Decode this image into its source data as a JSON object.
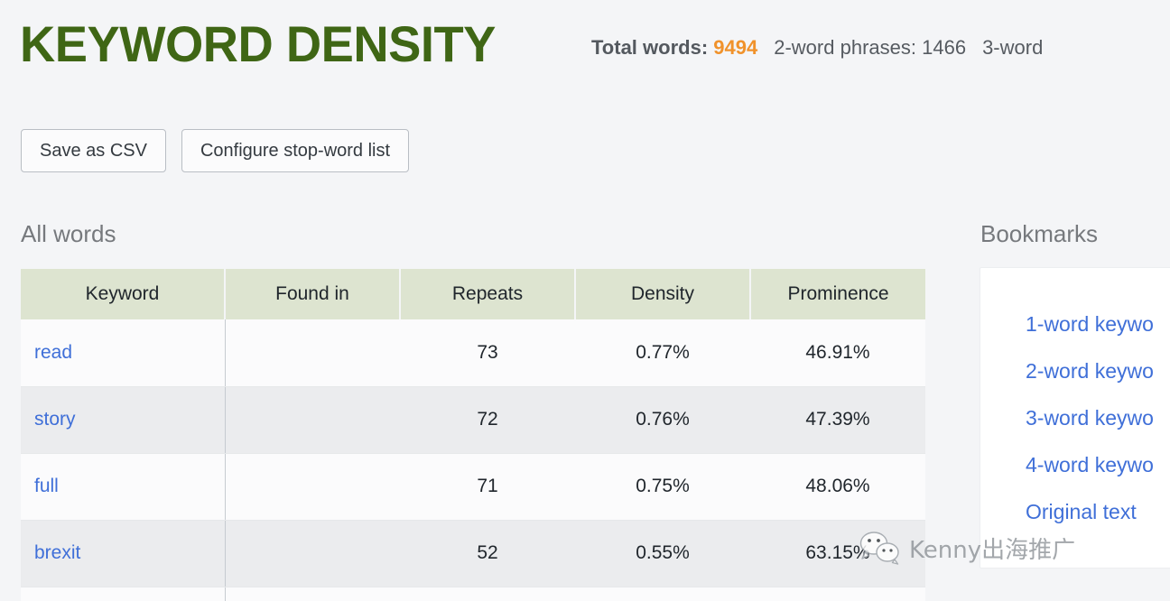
{
  "header": {
    "title": "KEYWORD DENSITY",
    "stats": {
      "total_words_label": "Total words:",
      "total_words_value": "9494",
      "two_word_label": "2-word phrases:",
      "two_word_value": "1466",
      "three_word_label": "3-word"
    }
  },
  "toolbar": {
    "save_csv_label": "Save as CSV",
    "configure_stopwords_label": "Configure stop-word list"
  },
  "sections": {
    "all_words_label": "All words",
    "bookmarks_label": "Bookmarks"
  },
  "table": {
    "columns": [
      "Keyword",
      "Found in",
      "Repeats",
      "Density",
      "Prominence"
    ],
    "rows": [
      {
        "keyword": "read",
        "found_in": "",
        "repeats": "73",
        "density": "0.77%",
        "prominence": "46.91%"
      },
      {
        "keyword": "story",
        "found_in": "",
        "repeats": "72",
        "density": "0.76%",
        "prominence": "47.39%"
      },
      {
        "keyword": "full",
        "found_in": "",
        "repeats": "71",
        "density": "0.75%",
        "prominence": "48.06%"
      },
      {
        "keyword": "brexit",
        "found_in": "",
        "repeats": "52",
        "density": "0.55%",
        "prominence": "63.15%"
      }
    ]
  },
  "bookmarks": {
    "items": [
      {
        "label": "1-word keywo"
      },
      {
        "label": "2-word keywo"
      },
      {
        "label": "3-word keywo"
      },
      {
        "label": "4-word keywo"
      },
      {
        "label": "Original text"
      }
    ]
  },
  "watermark": {
    "icon": "wechat-icon",
    "text": "Kenny出海推广"
  },
  "colors": {
    "title_green": "#3f6615",
    "accent_orange": "#f0922b",
    "link_blue": "#3f6fd8",
    "table_header_green": "#dde4d0",
    "page_background": "#f4f5f7"
  }
}
